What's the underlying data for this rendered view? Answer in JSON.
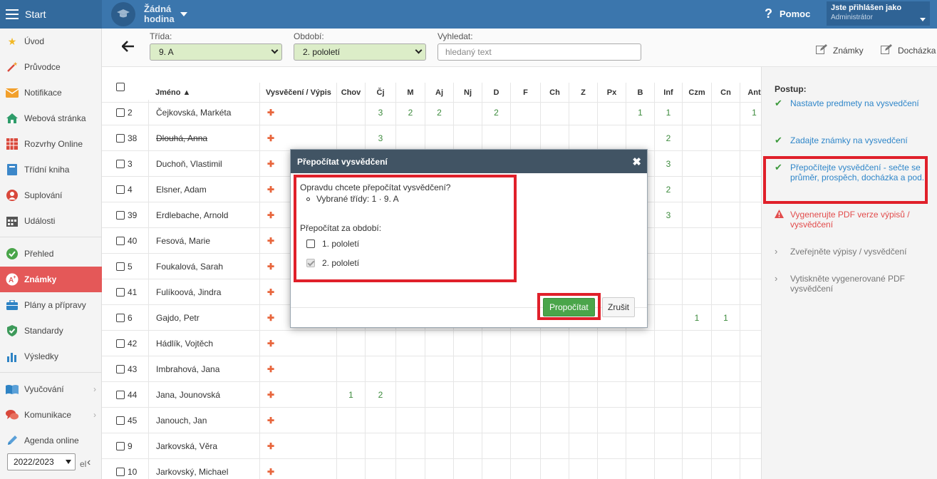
{
  "topbar": {
    "start_label": "Start",
    "lesson_line1": "Žádná",
    "lesson_line2": "hodina",
    "help_label": "Pomoc",
    "user_line1": "Jste přihlášen jako",
    "user_line2": "Administrátor"
  },
  "sidebar": {
    "items": [
      {
        "label": "Úvod",
        "icon": "star-icon"
      },
      {
        "label": "Průvodce",
        "icon": "magic-wand-icon"
      },
      {
        "label": "Notifikace",
        "icon": "envelope-icon"
      },
      {
        "label": "Webová stránka",
        "icon": "home-icon"
      },
      {
        "label": "Rozvrhy Online",
        "icon": "calendar-grid-icon"
      },
      {
        "label": "Třídní kniha",
        "icon": "book-icon"
      },
      {
        "label": "Suplování",
        "icon": "person-icon"
      },
      {
        "label": "Události",
        "icon": "calendar-icon"
      },
      {
        "label": "Přehled",
        "icon": "check-circle-icon"
      },
      {
        "label": "Známky",
        "icon": "grade-icon"
      },
      {
        "label": "Plány a přípravy",
        "icon": "briefcase-icon"
      },
      {
        "label": "Standardy",
        "icon": "shield-check-icon"
      },
      {
        "label": "Výsledky",
        "icon": "bar-chart-icon"
      },
      {
        "label": "Vyučování",
        "icon": "open-book-icon"
      },
      {
        "label": "Komunikace",
        "icon": "chat-icon"
      },
      {
        "label": "Agenda online",
        "icon": "pencil-icon"
      }
    ],
    "year": "2022/2023",
    "collapse_tail": "el"
  },
  "filter": {
    "class_label": "Třída:",
    "class_value": "9. A",
    "period_label": "Období:",
    "period_value": "2. pololetí",
    "search_label": "Vyhledat:",
    "search_placeholder": "hledaný text",
    "link_grades": "Známky",
    "link_attendance": "Docházka"
  },
  "table": {
    "headers": [
      "Jméno ▲",
      "Vysvěčení / Výpis",
      "Chov",
      "Čj",
      "M",
      "Aj",
      "Nj",
      "D",
      "F",
      "Ch",
      "Z",
      "Px",
      "B",
      "Inf",
      "Czm",
      "Cn",
      "Ant"
    ],
    "rows": [
      {
        "num": "2",
        "name": "Čejkovská, Markéta",
        "grades": [
          "",
          "3",
          "2",
          "2",
          "",
          "2",
          "",
          "",
          "",
          "",
          "1",
          "1",
          "",
          "",
          "1"
        ]
      },
      {
        "num": "38",
        "name": "Dlouhá, Anna",
        "strike": true,
        "grades": [
          "",
          "3",
          "",
          "",
          "",
          "",
          "",
          "",
          "",
          "",
          "",
          "2",
          "",
          "",
          ""
        ]
      },
      {
        "num": "3",
        "name": "Duchoň, Vlastimil",
        "grades": [
          "",
          "",
          "",
          "",
          "",
          "",
          "",
          "",
          "",
          "",
          "",
          "3",
          "",
          "",
          ""
        ]
      },
      {
        "num": "4",
        "name": "Elsner, Adam",
        "grades": [
          "",
          "",
          "",
          "",
          "",
          "",
          "",
          "",
          "",
          "",
          "",
          "2",
          "",
          "",
          ""
        ]
      },
      {
        "num": "39",
        "name": "Erdlebache, Arnold",
        "grades": [
          "",
          "",
          "",
          "",
          "",
          "",
          "",
          "",
          "",
          "",
          "",
          "3",
          "",
          "",
          ""
        ]
      },
      {
        "num": "40",
        "name": "Fesová, Marie",
        "grades": [
          "",
          "",
          "",
          "",
          "",
          "",
          "",
          "",
          "",
          "",
          "",
          "",
          "",
          "",
          ""
        ]
      },
      {
        "num": "5",
        "name": "Foukalová, Sarah",
        "grades": [
          "",
          "",
          "",
          "",
          "",
          "",
          "",
          "",
          "",
          "",
          "",
          "",
          "",
          "",
          ""
        ]
      },
      {
        "num": "41",
        "name": "Fulíkoová, Jindra",
        "grades": [
          "",
          "",
          "",
          "",
          "",
          "",
          "",
          "",
          "",
          "",
          "",
          "",
          "",
          "",
          ""
        ]
      },
      {
        "num": "6",
        "name": "Gajdo, Petr",
        "grades": [
          "",
          "",
          "",
          "",
          "",
          "",
          "",
          "",
          "",
          "",
          "",
          "",
          "1",
          "1",
          ""
        ]
      },
      {
        "num": "42",
        "name": "Hádlík, Vojtěch",
        "grades": [
          "",
          "",
          "",
          "",
          "",
          "",
          "",
          "",
          "",
          "",
          "",
          "",
          "",
          "",
          ""
        ]
      },
      {
        "num": "43",
        "name": "Imbrahová, Jana",
        "grades": [
          "",
          "",
          "",
          "",
          "",
          "",
          "",
          "",
          "",
          "",
          "",
          "",
          "",
          "",
          ""
        ]
      },
      {
        "num": "44",
        "name": "Jana, Jounovská",
        "grades": [
          "1",
          "2",
          "",
          "",
          "",
          "",
          "",
          "",
          "",
          "",
          "",
          "",
          "",
          "",
          ""
        ]
      },
      {
        "num": "45",
        "name": "Janouch, Jan",
        "grades": [
          "",
          "",
          "",
          "",
          "",
          "",
          "",
          "",
          "",
          "",
          "",
          "",
          "",
          "",
          ""
        ]
      },
      {
        "num": "9",
        "name": "Jarkovská, Věra",
        "grades": [
          "",
          "",
          "",
          "",
          "",
          "",
          "",
          "",
          "",
          "",
          "",
          "",
          "",
          "",
          ""
        ]
      },
      {
        "num": "10",
        "name": "Jarkovský, Michael",
        "grades": [
          "",
          "",
          "",
          "",
          "",
          "",
          "",
          "",
          "",
          "",
          "",
          "",
          "",
          "",
          ""
        ]
      }
    ]
  },
  "rpanel": {
    "title": "Postup:",
    "steps": [
      {
        "status": "done",
        "text": "Nastavte predmety na vysvedčení"
      },
      {
        "status": "done",
        "text": "Zadajte známky na vysvedčení"
      },
      {
        "status": "done",
        "text": "Přepočítejte vysvědčení - sečte se průměr, prospěch, docházka a pod."
      },
      {
        "status": "warn",
        "text": "Vygenerujte PDF verze výpisů / vysvědčení"
      },
      {
        "status": "todo",
        "text": "Zveřejněte výpisy / vysvědčení"
      },
      {
        "status": "todo",
        "text": "Vytiskněte vygenerované PDF vysvědčení"
      }
    ]
  },
  "modal": {
    "title": "Přepočítat vysvědčení",
    "question": "Opravdu chcete přepočítat vysvědčení?",
    "classes": "Vybrané třídy: 1 · 9. A",
    "period_label": "Přepočítat za období:",
    "option1": "1. pololetí",
    "option2": "2. pololetí",
    "confirm_label": "Propočítat",
    "cancel_label": "Zrušit"
  },
  "colors": {
    "topbar": "#3b76ad",
    "active_nav": "#e45858",
    "primary_button": "#4aa54a",
    "highlight": "#e0202a",
    "modal_header": "#415464"
  }
}
